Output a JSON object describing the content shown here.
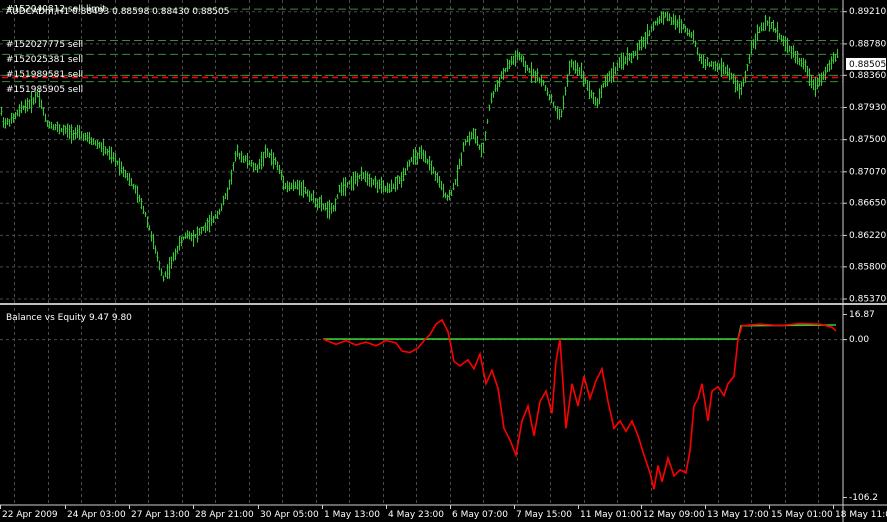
{
  "header": {
    "symbol_line": "AUDCADm,H1  0.88493 0.88598 0.88430 0.88505"
  },
  "orders": [
    {
      "label": "#152040812 sell limit",
      "price": 0.89245
    },
    {
      "label": "#152027775 sell",
      "price": 0.88825
    },
    {
      "label": "#152025381 sell",
      "price": 0.8864
    },
    {
      "label": "#151989581 sell",
      "price": 0.8836
    },
    {
      "label": "#151985905 sell",
      "price": 0.88275
    }
  ],
  "colors": {
    "background": "#000000",
    "grid": "#4a4a4a",
    "candles": "#33cc33",
    "order_line": "#3a8a3a",
    "sl_line": "#ff0000",
    "price_label_bg": "#ffffff",
    "balance": "#33cc33",
    "equity": "#ff0000"
  },
  "chart_data": [
    {
      "type": "bar",
      "title": "AUDCADm,H1",
      "current_price": "0.88505",
      "stop_level": 0.8833,
      "ylim": [
        0.8531,
        0.8936
      ],
      "ytick_labels": [
        "0.89210",
        "0.88780",
        "0.88505",
        "0.88360",
        "0.87930",
        "0.87500",
        "0.87070",
        "0.86650",
        "0.86220",
        "0.85800",
        "0.85370"
      ],
      "x_labels": [
        "22 Apr 2009",
        "24 Apr 03:00",
        "27 Apr 13:00",
        "28 Apr 21:00",
        "30 Apr 05:00",
        "1 May 13:00",
        "4 May 23:00",
        "6 May 07:00",
        "7 May 15:00",
        "11 May 01:00",
        "12 May 09:00",
        "13 May 17:00",
        "15 May 01:00",
        "18 May 11:00"
      ],
      "price_path": [
        [
          0,
          0.8791
        ],
        [
          4,
          0.877
        ],
        [
          12,
          0.8776
        ],
        [
          22,
          0.8792
        ],
        [
          32,
          0.88
        ],
        [
          38,
          0.8812
        ],
        [
          46,
          0.8772
        ],
        [
          60,
          0.8763
        ],
        [
          80,
          0.8756
        ],
        [
          100,
          0.8741
        ],
        [
          115,
          0.8722
        ],
        [
          125,
          0.8705
        ],
        [
          135,
          0.8682
        ],
        [
          145,
          0.865
        ],
        [
          152,
          0.8617
        ],
        [
          158,
          0.8585
        ],
        [
          163,
          0.8565
        ],
        [
          170,
          0.8581
        ],
        [
          178,
          0.8607
        ],
        [
          186,
          0.8623
        ],
        [
          194,
          0.862
        ],
        [
          202,
          0.8629
        ],
        [
          210,
          0.8638
        ],
        [
          220,
          0.8656
        ],
        [
          228,
          0.8683
        ],
        [
          236,
          0.8732
        ],
        [
          246,
          0.8722
        ],
        [
          256,
          0.871
        ],
        [
          266,
          0.8733
        ],
        [
          276,
          0.8718
        ],
        [
          286,
          0.8686
        ],
        [
          300,
          0.8688
        ],
        [
          316,
          0.8666
        ],
        [
          332,
          0.8653
        ],
        [
          340,
          0.8686
        ],
        [
          352,
          0.8694
        ],
        [
          364,
          0.8702
        ],
        [
          376,
          0.869
        ],
        [
          388,
          0.8682
        ],
        [
          400,
          0.8695
        ],
        [
          410,
          0.8722
        ],
        [
          420,
          0.873
        ],
        [
          430,
          0.8716
        ],
        [
          440,
          0.8688
        ],
        [
          448,
          0.867
        ],
        [
          456,
          0.8696
        ],
        [
          464,
          0.8746
        ],
        [
          474,
          0.8758
        ],
        [
          482,
          0.8728
        ],
        [
          490,
          0.8801
        ],
        [
          500,
          0.8832
        ],
        [
          510,
          0.8852
        ],
        [
          518,
          0.8862
        ],
        [
          526,
          0.8845
        ],
        [
          534,
          0.8838
        ],
        [
          544,
          0.8822
        ],
        [
          552,
          0.8799
        ],
        [
          560,
          0.8778
        ],
        [
          570,
          0.8851
        ],
        [
          580,
          0.8842
        ],
        [
          588,
          0.882
        ],
        [
          596,
          0.8796
        ],
        [
          604,
          0.8826
        ],
        [
          614,
          0.8841
        ],
        [
          624,
          0.8857
        ],
        [
          634,
          0.8862
        ],
        [
          644,
          0.8883
        ],
        [
          654,
          0.8903
        ],
        [
          664,
          0.8917
        ],
        [
          672,
          0.8908
        ],
        [
          682,
          0.8902
        ],
        [
          692,
          0.8888
        ],
        [
          700,
          0.8856
        ],
        [
          712,
          0.8848
        ],
        [
          724,
          0.8845
        ],
        [
          734,
          0.8828
        ],
        [
          740,
          0.8812
        ],
        [
          746,
          0.8839
        ],
        [
          752,
          0.8878
        ],
        [
          760,
          0.8898
        ],
        [
          768,
          0.8905
        ],
        [
          776,
          0.8895
        ],
        [
          786,
          0.8875
        ],
        [
          796,
          0.886
        ],
        [
          806,
          0.8844
        ],
        [
          814,
          0.882
        ],
        [
          822,
          0.8834
        ],
        [
          830,
          0.885
        ],
        [
          838,
          0.8864
        ],
        [
          842,
          0.885
        ]
      ]
    },
    {
      "type": "line",
      "title": "Balance vs Equity 9.47 9.80",
      "ylim": [
        -106.2,
        16.87
      ],
      "ytick_labels": [
        "16.87",
        "0.00",
        "-106.2"
      ],
      "series": [
        {
          "name": "Balance",
          "color": "#33cc33",
          "points": [
            [
              323,
              0.0
            ],
            [
              738,
              0.0
            ],
            [
              741,
              9.0
            ],
            [
              836,
              9.5
            ]
          ]
        },
        {
          "name": "Equity",
          "color": "#ff0000",
          "points": [
            [
              323,
              0.0
            ],
            [
              336,
              -3.5
            ],
            [
              346,
              -1.0
            ],
            [
              356,
              -4.0
            ],
            [
              366,
              -2.0
            ],
            [
              376,
              -4.5
            ],
            [
              386,
              -1.0
            ],
            [
              396,
              -2.5
            ],
            [
              402,
              -8.0
            ],
            [
              410,
              -9.0
            ],
            [
              418,
              -6.0
            ],
            [
              424,
              -1.0
            ],
            [
              430,
              3.0
            ],
            [
              436,
              10.0
            ],
            [
              442,
              13.0
            ],
            [
              448,
              5.0
            ],
            [
              454,
              -15.0
            ],
            [
              460,
              -18.0
            ],
            [
              468,
              -14.0
            ],
            [
              474,
              -20.0
            ],
            [
              480,
              -10.0
            ],
            [
              486,
              -30.0
            ],
            [
              492,
              -21.0
            ],
            [
              498,
              -33.0
            ],
            [
              504,
              -60.0
            ],
            [
              510,
              -68.0
            ],
            [
              516,
              -78.0
            ],
            [
              522,
              -55.0
            ],
            [
              528,
              -45.0
            ],
            [
              534,
              -65.0
            ],
            [
              540,
              -42.0
            ],
            [
              546,
              -35.0
            ],
            [
              552,
              -50.0
            ],
            [
              556,
              -15.0
            ],
            [
              560,
              0.0
            ],
            [
              566,
              -60.0
            ],
            [
              572,
              -30.0
            ],
            [
              578,
              -45.0
            ],
            [
              584,
              -25.0
            ],
            [
              590,
              -40.0
            ],
            [
              596,
              -28.0
            ],
            [
              602,
              -20.0
            ],
            [
              608,
              -42.0
            ],
            [
              614,
              -60.0
            ],
            [
              620,
              -55.0
            ],
            [
              626,
              -62.0
            ],
            [
              632,
              -55.0
            ],
            [
              638,
              -65.0
            ],
            [
              644,
              -78.0
            ],
            [
              650,
              -90.0
            ],
            [
              654,
              -101.0
            ],
            [
              658,
              -85.0
            ],
            [
              662,
              -96.0
            ],
            [
              668,
              -80.0
            ],
            [
              674,
              -92.0
            ],
            [
              680,
              -88.0
            ],
            [
              686,
              -90.0
            ],
            [
              690,
              -75.0
            ],
            [
              694,
              -45.0
            ],
            [
              698,
              -40.0
            ],
            [
              702,
              -30.0
            ],
            [
              708,
              -55.0
            ],
            [
              712,
              -35.0
            ],
            [
              718,
              -32.0
            ],
            [
              724,
              -38.0
            ],
            [
              728,
              -30.0
            ],
            [
              734,
              -25.0
            ],
            [
              738,
              0.0
            ],
            [
              742,
              9.0
            ],
            [
              760,
              10.0
            ],
            [
              780,
              9.0
            ],
            [
              800,
              10.5
            ],
            [
              820,
              10.0
            ],
            [
              832,
              8.0
            ],
            [
              836,
              5.5
            ]
          ]
        }
      ]
    }
  ]
}
